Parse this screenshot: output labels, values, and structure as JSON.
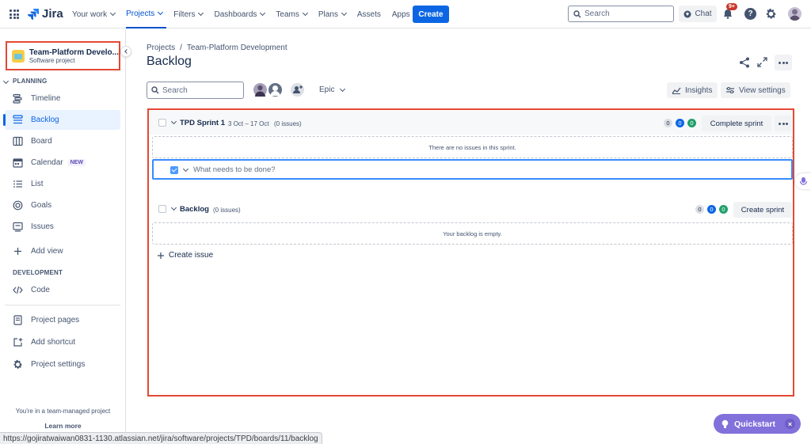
{
  "app": {
    "name": "Jira"
  },
  "topnav": {
    "items": [
      {
        "label": "Your work",
        "dropdown": true
      },
      {
        "label": "Projects",
        "dropdown": true,
        "active": true
      },
      {
        "label": "Filters",
        "dropdown": true
      },
      {
        "label": "Dashboards",
        "dropdown": true
      },
      {
        "label": "Teams",
        "dropdown": true
      },
      {
        "label": "Plans",
        "dropdown": true
      },
      {
        "label": "Assets",
        "dropdown": false
      },
      {
        "label": "Apps",
        "dropdown": true
      }
    ],
    "create_label": "Create",
    "search_placeholder": "Search",
    "chat_label": "Chat",
    "notification_count": "9+",
    "help_glyph": "?"
  },
  "sidebar": {
    "project_name": "Team-Platform Develo...",
    "project_type": "Software project",
    "planning_label": "PLANNING",
    "planning_items": [
      {
        "label": "Timeline",
        "icon": "timeline-icon"
      },
      {
        "label": "Backlog",
        "icon": "backlog-icon",
        "active": true
      },
      {
        "label": "Board",
        "icon": "board-icon"
      },
      {
        "label": "Calendar",
        "icon": "calendar-icon",
        "badge": "NEW"
      },
      {
        "label": "List",
        "icon": "list-icon"
      },
      {
        "label": "Goals",
        "icon": "goals-icon"
      },
      {
        "label": "Issues",
        "icon": "issues-icon"
      }
    ],
    "add_view_label": "Add view",
    "development_label": "DEVELOPMENT",
    "code_label": "Code",
    "project_pages_label": "Project pages",
    "add_shortcut_label": "Add shortcut",
    "project_settings_label": "Project settings",
    "footer_text": "You're in a team-managed project",
    "learn_more_label": "Learn more"
  },
  "main": {
    "breadcrumb": [
      "Projects",
      "/",
      "Team-Platform Development"
    ],
    "title": "Backlog",
    "search_placeholder": "Search",
    "epic_label": "Epic",
    "insights_label": "Insights",
    "view_settings_label": "View settings",
    "sprint": {
      "name": "TPD Sprint 1",
      "dates": "3 Oct – 17 Oct",
      "issue_count": "(0 issues)",
      "counts": [
        "0",
        "0",
        "0"
      ],
      "complete_label": "Complete sprint",
      "empty_text": "There are no issues in this sprint.",
      "create_placeholder": "What needs to be done?"
    },
    "backlog": {
      "name": "Backlog",
      "issue_count": "(0 issues)",
      "counts": [
        "0",
        "0",
        "0"
      ],
      "create_sprint_label": "Create sprint",
      "empty_text": "Your backlog is empty.",
      "create_issue_label": "Create issue"
    }
  },
  "status_url": "https://gojiratwaiwan0831-1130.atlassian.net/jira/software/projects/TPD/boards/11/backlog",
  "quickstart": {
    "label": "Quickstart",
    "close_glyph": "×"
  },
  "colors": {
    "brand": "#0c66e4",
    "highlight": "#e34935",
    "quickstart": "#8270db"
  }
}
